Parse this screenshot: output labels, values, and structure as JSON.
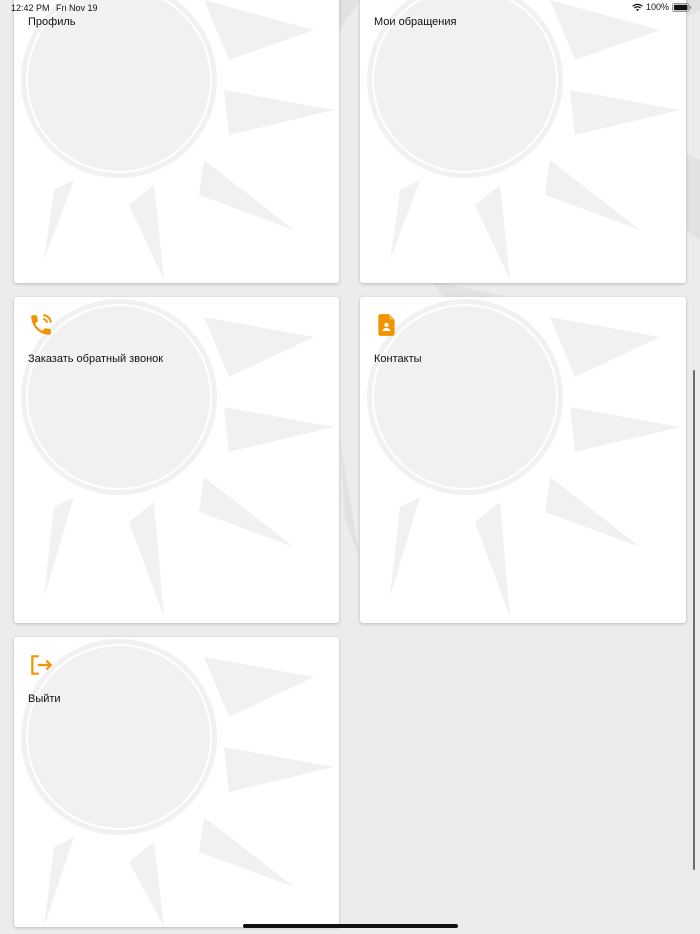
{
  "status_bar": {
    "time": "12:42 PM",
    "date": "Fri Nov 19",
    "battery": "100%"
  },
  "menu": {
    "items": [
      {
        "label": "Профиль",
        "icon": "profile-icon"
      },
      {
        "label": "Мои обращения",
        "icon": "appeals-icon"
      },
      {
        "label": "Заказать обратный звонок",
        "icon": "phone-callback-icon"
      },
      {
        "label": "Контакты",
        "icon": "contact-document-icon"
      },
      {
        "label": "Выйти",
        "icon": "logout-icon"
      }
    ]
  },
  "colors": {
    "accent": "#F29300",
    "background": "#ECECEC",
    "card": "#FFFFFF"
  }
}
